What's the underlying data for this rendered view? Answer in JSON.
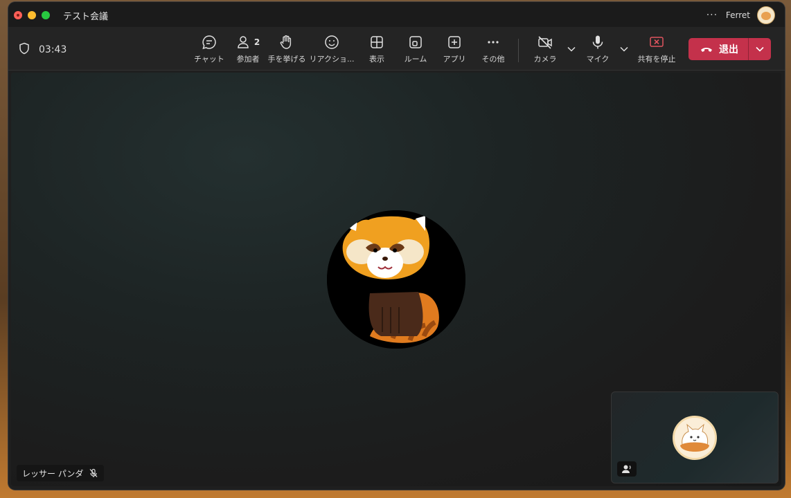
{
  "window": {
    "title": "テスト会議",
    "user_name": "Ferret",
    "more_icon": "more-horizontal-icon"
  },
  "meeting": {
    "elapsed": "03:43",
    "shield_icon": "shield-icon"
  },
  "toolbar": {
    "chat": "チャット",
    "participants": "参加者",
    "participants_count": "2",
    "raise_hand": "手を挙げる",
    "reactions": "リアクショ...",
    "view": "表示",
    "rooms": "ルーム",
    "apps": "アプリ",
    "more": "その他",
    "camera": "カメラ",
    "mic": "マイク",
    "stop_share": "共有を停止",
    "leave": "退出"
  },
  "stage": {
    "participant_name": "レッサー パンダ",
    "participant_muted": true
  },
  "colors": {
    "leave": "#c4314b",
    "stop_share": "#e0545f",
    "background": "#1f1f1f"
  }
}
